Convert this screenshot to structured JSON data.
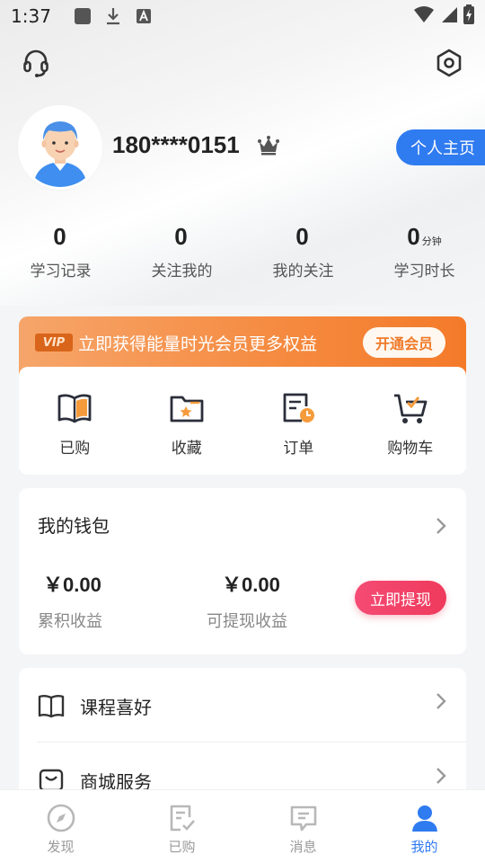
{
  "status_bar": {
    "time": "1:37"
  },
  "profile": {
    "username": "180****0151",
    "home_button": "个人主页"
  },
  "stats": [
    {
      "value": "0",
      "unit": "",
      "label": "学习记录"
    },
    {
      "value": "0",
      "unit": "",
      "label": "关注我的"
    },
    {
      "value": "0",
      "unit": "",
      "label": "我的关注"
    },
    {
      "value": "0",
      "unit": "分钟",
      "label": "学习时长"
    }
  ],
  "vip": {
    "tag": "VIP",
    "text": "立即获得能量时光会员更多权益",
    "button": "开通会员"
  },
  "actions": [
    {
      "label": "已购",
      "icon": "book-icon"
    },
    {
      "label": "收藏",
      "icon": "folder-star-icon"
    },
    {
      "label": "订单",
      "icon": "order-icon"
    },
    {
      "label": "购物车",
      "icon": "cart-icon"
    }
  ],
  "wallet": {
    "title": "我的钱包",
    "total_amount": "￥0.00",
    "total_label": "累积收益",
    "withdrawable_amount": "￥0.00",
    "withdrawable_label": "可提现收益",
    "withdraw_button": "立即提现"
  },
  "menu": [
    {
      "label": "课程喜好",
      "icon": "book-outline-icon"
    },
    {
      "label": "商城服务",
      "icon": "bag-icon"
    }
  ],
  "bottom_nav": [
    {
      "label": "发现",
      "icon": "compass-icon",
      "active": false
    },
    {
      "label": "已购",
      "icon": "purchased-icon",
      "active": false
    },
    {
      "label": "消息",
      "icon": "message-icon",
      "active": false
    },
    {
      "label": "我的",
      "icon": "user-icon",
      "active": true
    }
  ],
  "colors": {
    "accent": "#2f7bf0",
    "vip_orange": "#f58a3f",
    "withdraw_red": "#ef3a5c",
    "icon_dark": "#2b2f3a",
    "icon_orange": "#f59b3c"
  }
}
